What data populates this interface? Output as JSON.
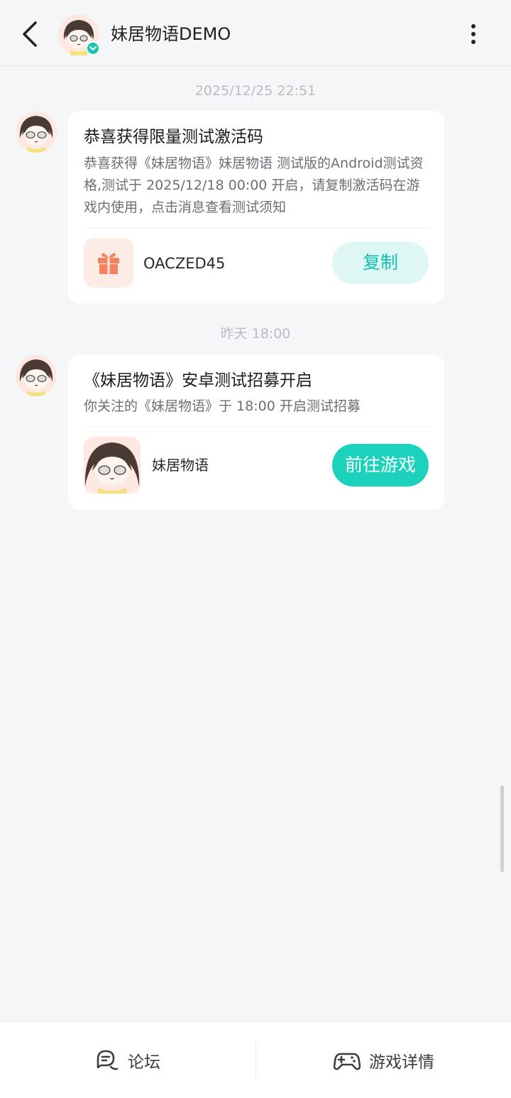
{
  "header": {
    "title": "妹居物语DEMO",
    "back_icon": "chevron-left-icon",
    "more_icon": "more-vertical-icon",
    "verified_badge": "verified-check-icon"
  },
  "messages": [
    {
      "timestamp": "2025/12/25  22:51",
      "title": "恭喜获得限量测试激活码",
      "body": "恭喜获得《妹居物语》妹居物语 测试版的Android测试资格,测试于 2025/12/18 00:00 开启，请复制激活码在游戏内使用，点击消息查看测试须知",
      "code_icon": "gift-icon",
      "code": "OACZED45",
      "action_label": "复制"
    },
    {
      "timestamp": "昨天  18:00",
      "title": "《妹居物语》安卓测试招募开启",
      "body": "你关注的《妹居物语》于 18:00 开启测试招募",
      "game_name": "妹居物语",
      "action_label": "前往游戏"
    }
  ],
  "bottom_bar": {
    "forum_label": "论坛",
    "forum_icon": "chat-bubbles-icon",
    "details_label": "游戏详情",
    "details_icon": "gamepad-icon"
  },
  "colors": {
    "accent": "#1dd2bd",
    "accent_light": "#def7f5",
    "gift": "#f5825f",
    "background": "#f5f6f8"
  }
}
